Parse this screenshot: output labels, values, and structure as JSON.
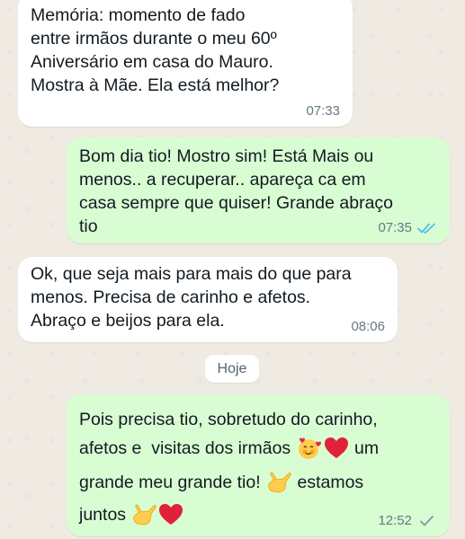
{
  "chat": {
    "messages": [
      {
        "direction": "incoming",
        "text": "Memória: momento de fado\nentre irmãos durante o meu 60º\nAniversário em casa do Mauro.\nMostra à Mãe. Ela está melhor?",
        "time": "07:33"
      },
      {
        "direction": "outgoing",
        "text": "Bom dia tio! Mostro sim! Está Mais ou\nmenos.. a recuperar.. apareça ca em\ncasa sempre que quiser!  Grande abraço\ntio",
        "time": "07:35",
        "status_icon": "double-check-read-icon"
      },
      {
        "direction": "incoming",
        "text": "Ok,  que seja mais para mais do que para\nmenos. Precisa de carinho e afetos.\nAbraço e beijos para ela.",
        "time": "08:06"
      },
      {
        "direction": "outgoing",
        "line1": "Pois precisa tio, sobretudo do carinho,",
        "line2a": "afetos e  visitas dos irmãos ",
        "line2b": " um",
        "line3a": "grande meu grande tio! ",
        "line3b": " estamos",
        "line4a": "juntos ",
        "emojis": [
          "smiling-face-with-hearts-emoji",
          "red-heart-emoji",
          "call-me-hand-emoji",
          "call-me-hand-emoji",
          "red-heart-emoji"
        ],
        "time": "12:52",
        "status_icon": "double-check-sent-icon"
      }
    ],
    "date_separator": "Hoje"
  },
  "colors": {
    "background": "#efeae2",
    "incoming_bubble": "#ffffff",
    "outgoing_bubble": "#d9fdd3",
    "read_tick": "#53bdeb",
    "sent_tick": "#8696a0",
    "meta_text": "#667781"
  }
}
